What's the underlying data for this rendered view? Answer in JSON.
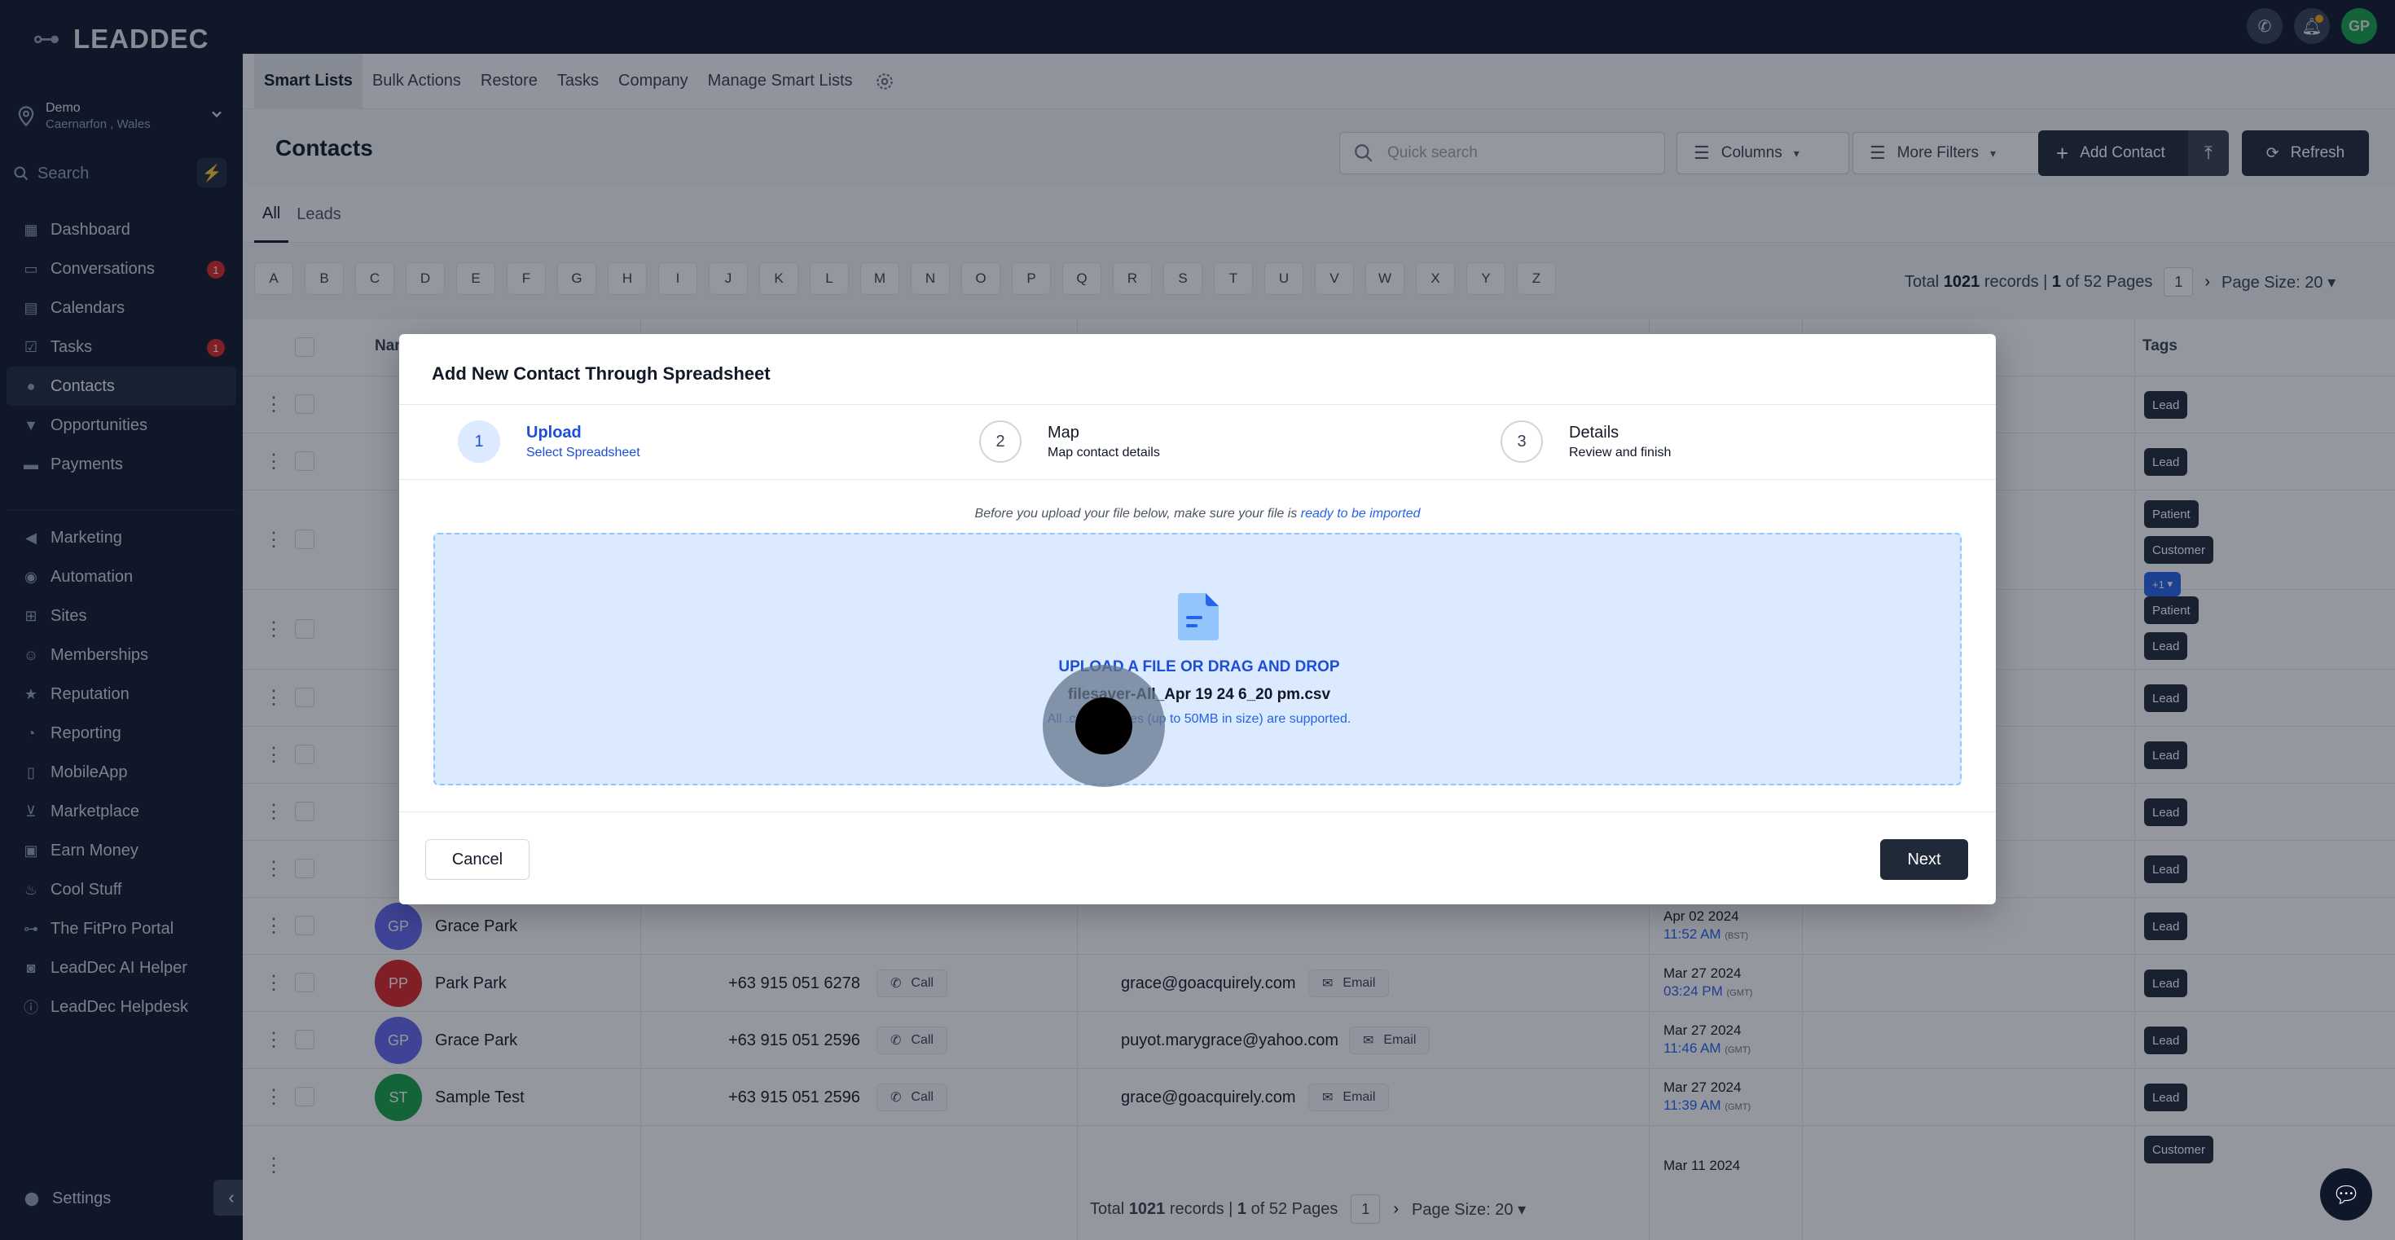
{
  "brand": {
    "name": "LEADDEC"
  },
  "location": {
    "name": "Demo",
    "sub": "Caernarfon , Wales"
  },
  "sidebar": {
    "search_placeholder": "Search",
    "items": [
      {
        "label": "Dashboard",
        "icon": "dashboard-icon"
      },
      {
        "label": "Conversations",
        "icon": "chat-icon",
        "badge": "1"
      },
      {
        "label": "Calendars",
        "icon": "calendar-icon"
      },
      {
        "label": "Tasks",
        "icon": "check-icon",
        "badge": "1"
      },
      {
        "label": "Contacts",
        "icon": "user-icon",
        "active": true
      },
      {
        "label": "Opportunities",
        "icon": "funnel-icon"
      },
      {
        "label": "Payments",
        "icon": "card-icon"
      },
      {
        "label": "Marketing",
        "icon": "megaphone-icon"
      },
      {
        "label": "Automation",
        "icon": "automation-icon"
      },
      {
        "label": "Sites",
        "icon": "sitemap-icon"
      },
      {
        "label": "Memberships",
        "icon": "members-icon"
      },
      {
        "label": "Reputation",
        "icon": "star-icon"
      },
      {
        "label": "Reporting",
        "icon": "chart-icon"
      },
      {
        "label": "MobileApp",
        "icon": "mobile-icon"
      },
      {
        "label": "Marketplace",
        "icon": "cart-icon"
      },
      {
        "label": "Earn Money",
        "icon": "money-icon"
      },
      {
        "label": "Cool Stuff",
        "icon": "flame-icon"
      },
      {
        "label": "The FitPro Portal",
        "icon": "dumbbell-icon"
      },
      {
        "label": "LeadDec AI Helper",
        "icon": "robot-icon"
      },
      {
        "label": "LeadDec Helpdesk",
        "icon": "info-icon"
      }
    ],
    "settings_label": "Settings"
  },
  "topbar": {
    "avatar_initials": "GP"
  },
  "subnav": {
    "tabs": [
      "Smart Lists",
      "Bulk Actions",
      "Restore",
      "Tasks",
      "Company",
      "Manage Smart Lists"
    ]
  },
  "page": {
    "title": "Contacts",
    "quick_search_placeholder": "Quick search",
    "columns_label": "Columns",
    "more_filters_label": "More Filters",
    "add_contact_label": "Add Contact",
    "refresh_label": "Refresh",
    "view_tabs": [
      "All",
      "Leads"
    ],
    "letters": [
      "A",
      "B",
      "C",
      "D",
      "E",
      "F",
      "G",
      "H",
      "I",
      "J",
      "K",
      "L",
      "M",
      "N",
      "O",
      "P",
      "Q",
      "R",
      "S",
      "T",
      "U",
      "V",
      "W",
      "X",
      "Y",
      "Z"
    ],
    "pager": {
      "prefix": "Total",
      "total": "1021",
      "mid": "records |",
      "page": "1",
      "of": "of 52 Pages",
      "current": "1",
      "page_size": "Page Size: 20"
    }
  },
  "table": {
    "headers": {
      "name": "Name",
      "tags": "Tags"
    },
    "call_label": "Call",
    "email_label": "Email",
    "rows": [
      {
        "initials": "GP",
        "color": "#6366f1",
        "name": "Grace Park",
        "phone": "",
        "email": "",
        "date": "Apr 02 2024",
        "time": "11:52 AM",
        "tz": "(BST)",
        "tag": "Lead"
      },
      {
        "initials": "PP",
        "color": "#dc2626",
        "name": "Park Park",
        "phone": "+63 915 051 6278",
        "email": "grace@goacquirely.com",
        "date": "Mar 27 2024",
        "time": "03:24 PM",
        "tz": "(GMT)",
        "tag": "Lead"
      },
      {
        "initials": "GP",
        "color": "#6366f1",
        "name": "Grace Park",
        "phone": "+63 915 051 2596",
        "email": "puyot.marygrace@yahoo.com",
        "date": "Mar 27 2024",
        "time": "11:46 AM",
        "tz": "(GMT)",
        "tag": "Lead"
      },
      {
        "initials": "ST",
        "color": "#16a34a",
        "name": "Sample Test",
        "phone": "+63 915 051 2596",
        "email": "grace@goacquirely.com",
        "date": "Mar 27 2024",
        "time": "11:39 AM",
        "tz": "(GMT)",
        "tag": "Lead"
      }
    ],
    "extra_tags": {
      "patient": "Patient",
      "customer": "Customer",
      "lead": "Lead",
      "more": "+1"
    },
    "partial_date": "Mar 11 2024"
  },
  "modal": {
    "title": "Add New Contact Through Spreadsheet",
    "steps": [
      {
        "num": "1",
        "title": "Upload",
        "sub": "Select Spreadsheet"
      },
      {
        "num": "2",
        "title": "Map",
        "sub": "Map contact details"
      },
      {
        "num": "3",
        "title": "Details",
        "sub": "Review and finish"
      }
    ],
    "notice_prefix": "Before you upload your file below, make sure your file is",
    "notice_link": "ready to be imported",
    "dropzone_title": "UPLOAD A FILE OR DRAG AND DROP",
    "file_name": "filesaver-All_Apr 19 24 6_20 pm.csv",
    "hint": "All .csv file types (up to 50MB in size) are supported.",
    "cancel_label": "Cancel",
    "next_label": "Next"
  }
}
